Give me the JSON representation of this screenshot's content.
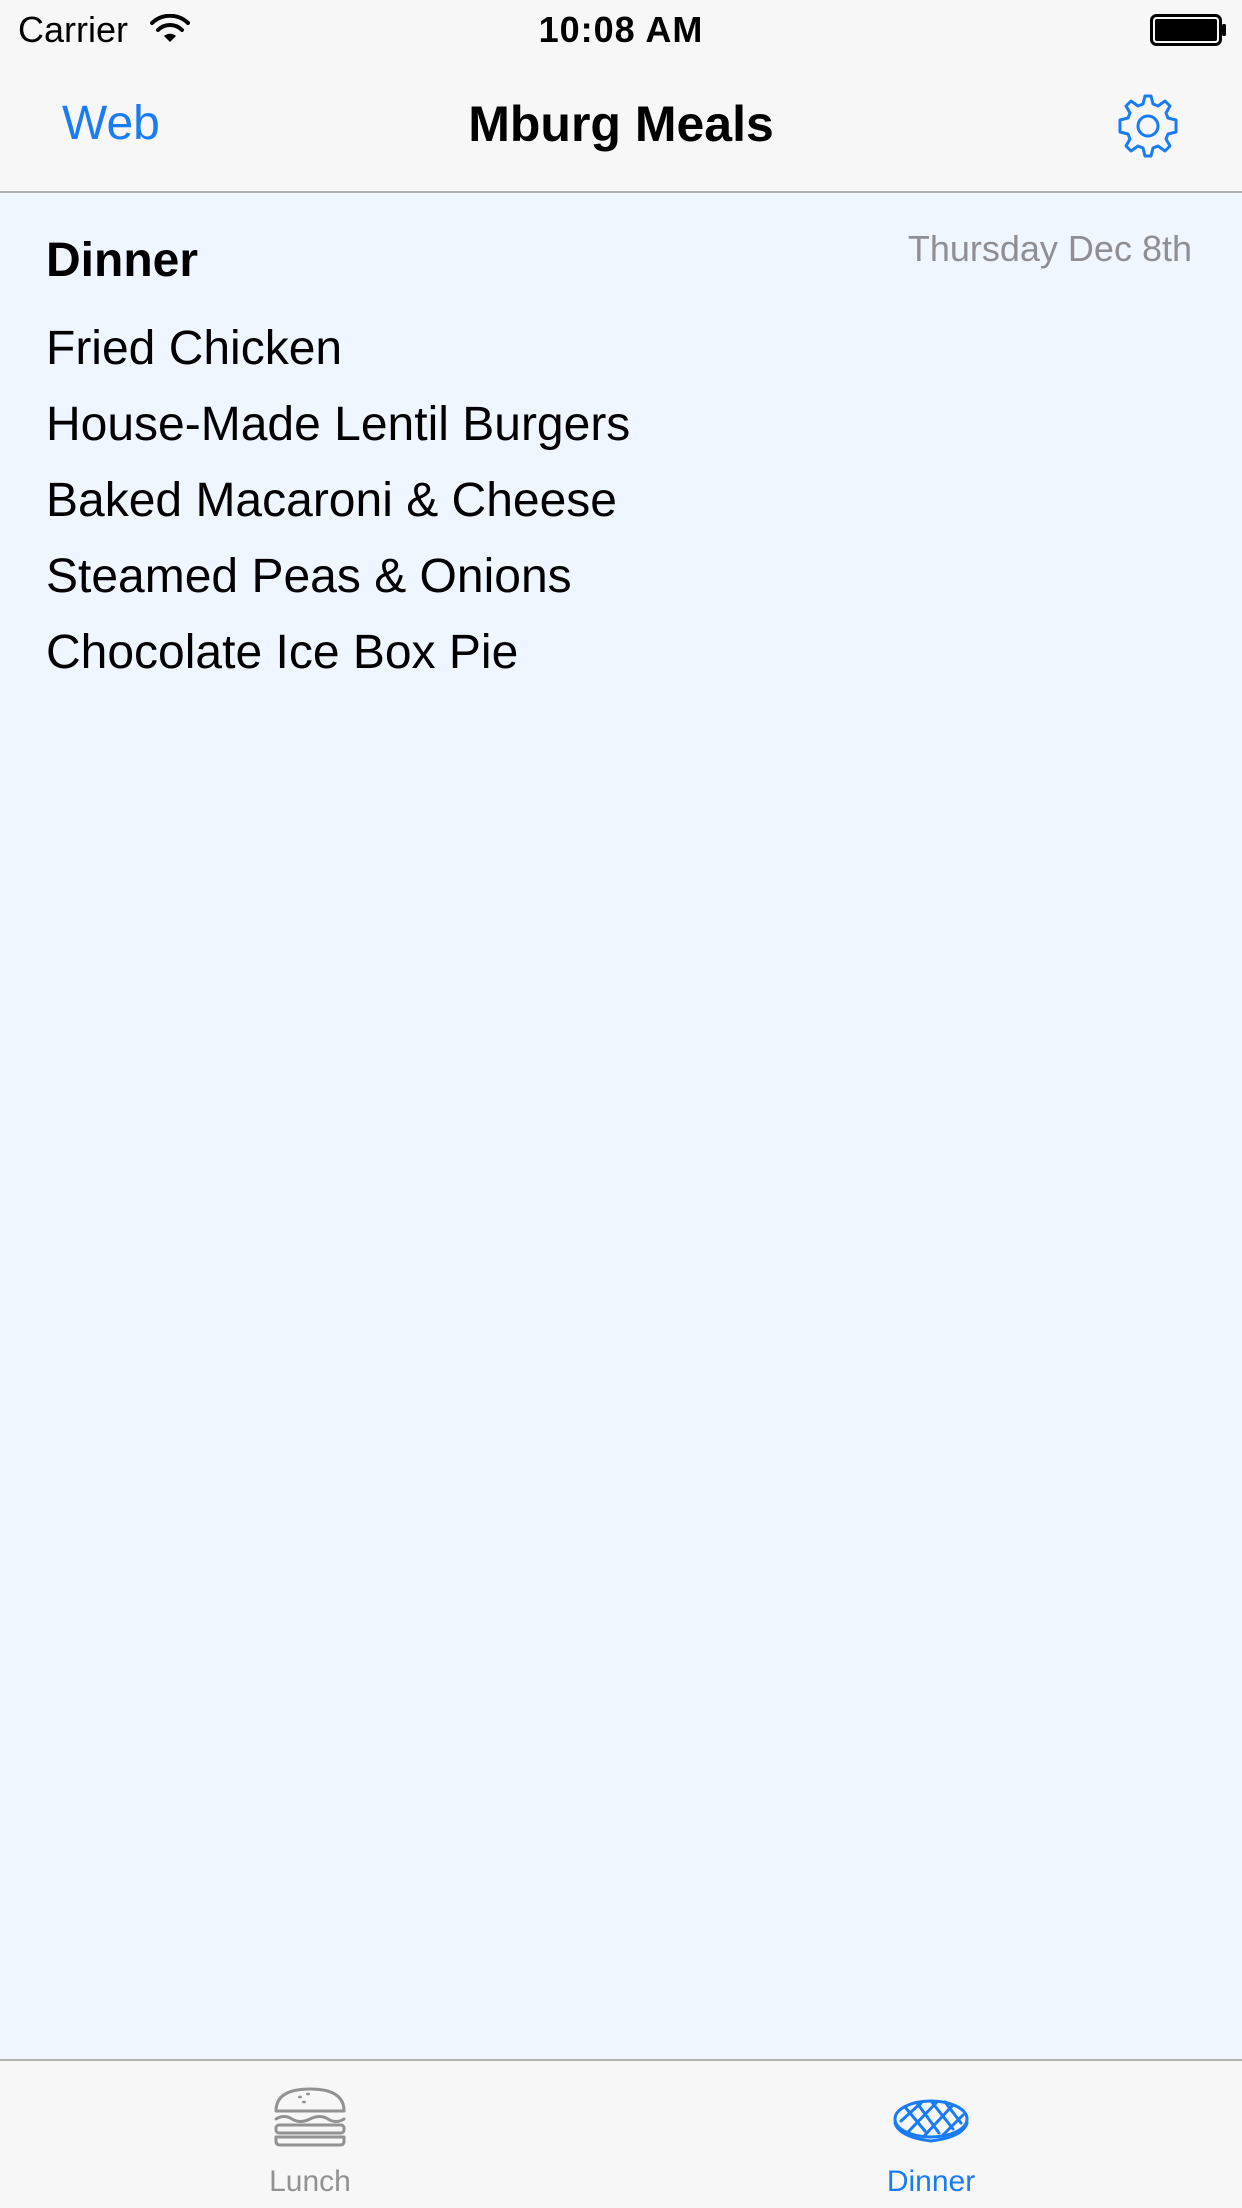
{
  "status_bar": {
    "carrier": "Carrier",
    "time": "10:08 AM",
    "wifi_icon": "wifi-icon",
    "battery_icon": "battery-icon"
  },
  "nav": {
    "left_button": "Web",
    "title": "Mburg Meals",
    "right_icon": "gear-icon"
  },
  "meal": {
    "heading": "Dinner",
    "date": "Thursday Dec 8th",
    "items": [
      "Fried Chicken",
      "House-Made Lentil Burgers",
      "Baked Macaroni & Cheese",
      "Steamed Peas & Onions",
      "Chocolate Ice Box Pie"
    ]
  },
  "tabs": [
    {
      "label": "Lunch",
      "icon": "burger-icon",
      "selected": false
    },
    {
      "label": "Dinner",
      "icon": "steak-icon",
      "selected": true
    }
  ],
  "colors": {
    "accent": "#1a7cf4",
    "background": "#f0f6ff",
    "bar_background": "#f7f7f7",
    "inactive_tab": "#929292",
    "date_text": "#8e8e93"
  }
}
